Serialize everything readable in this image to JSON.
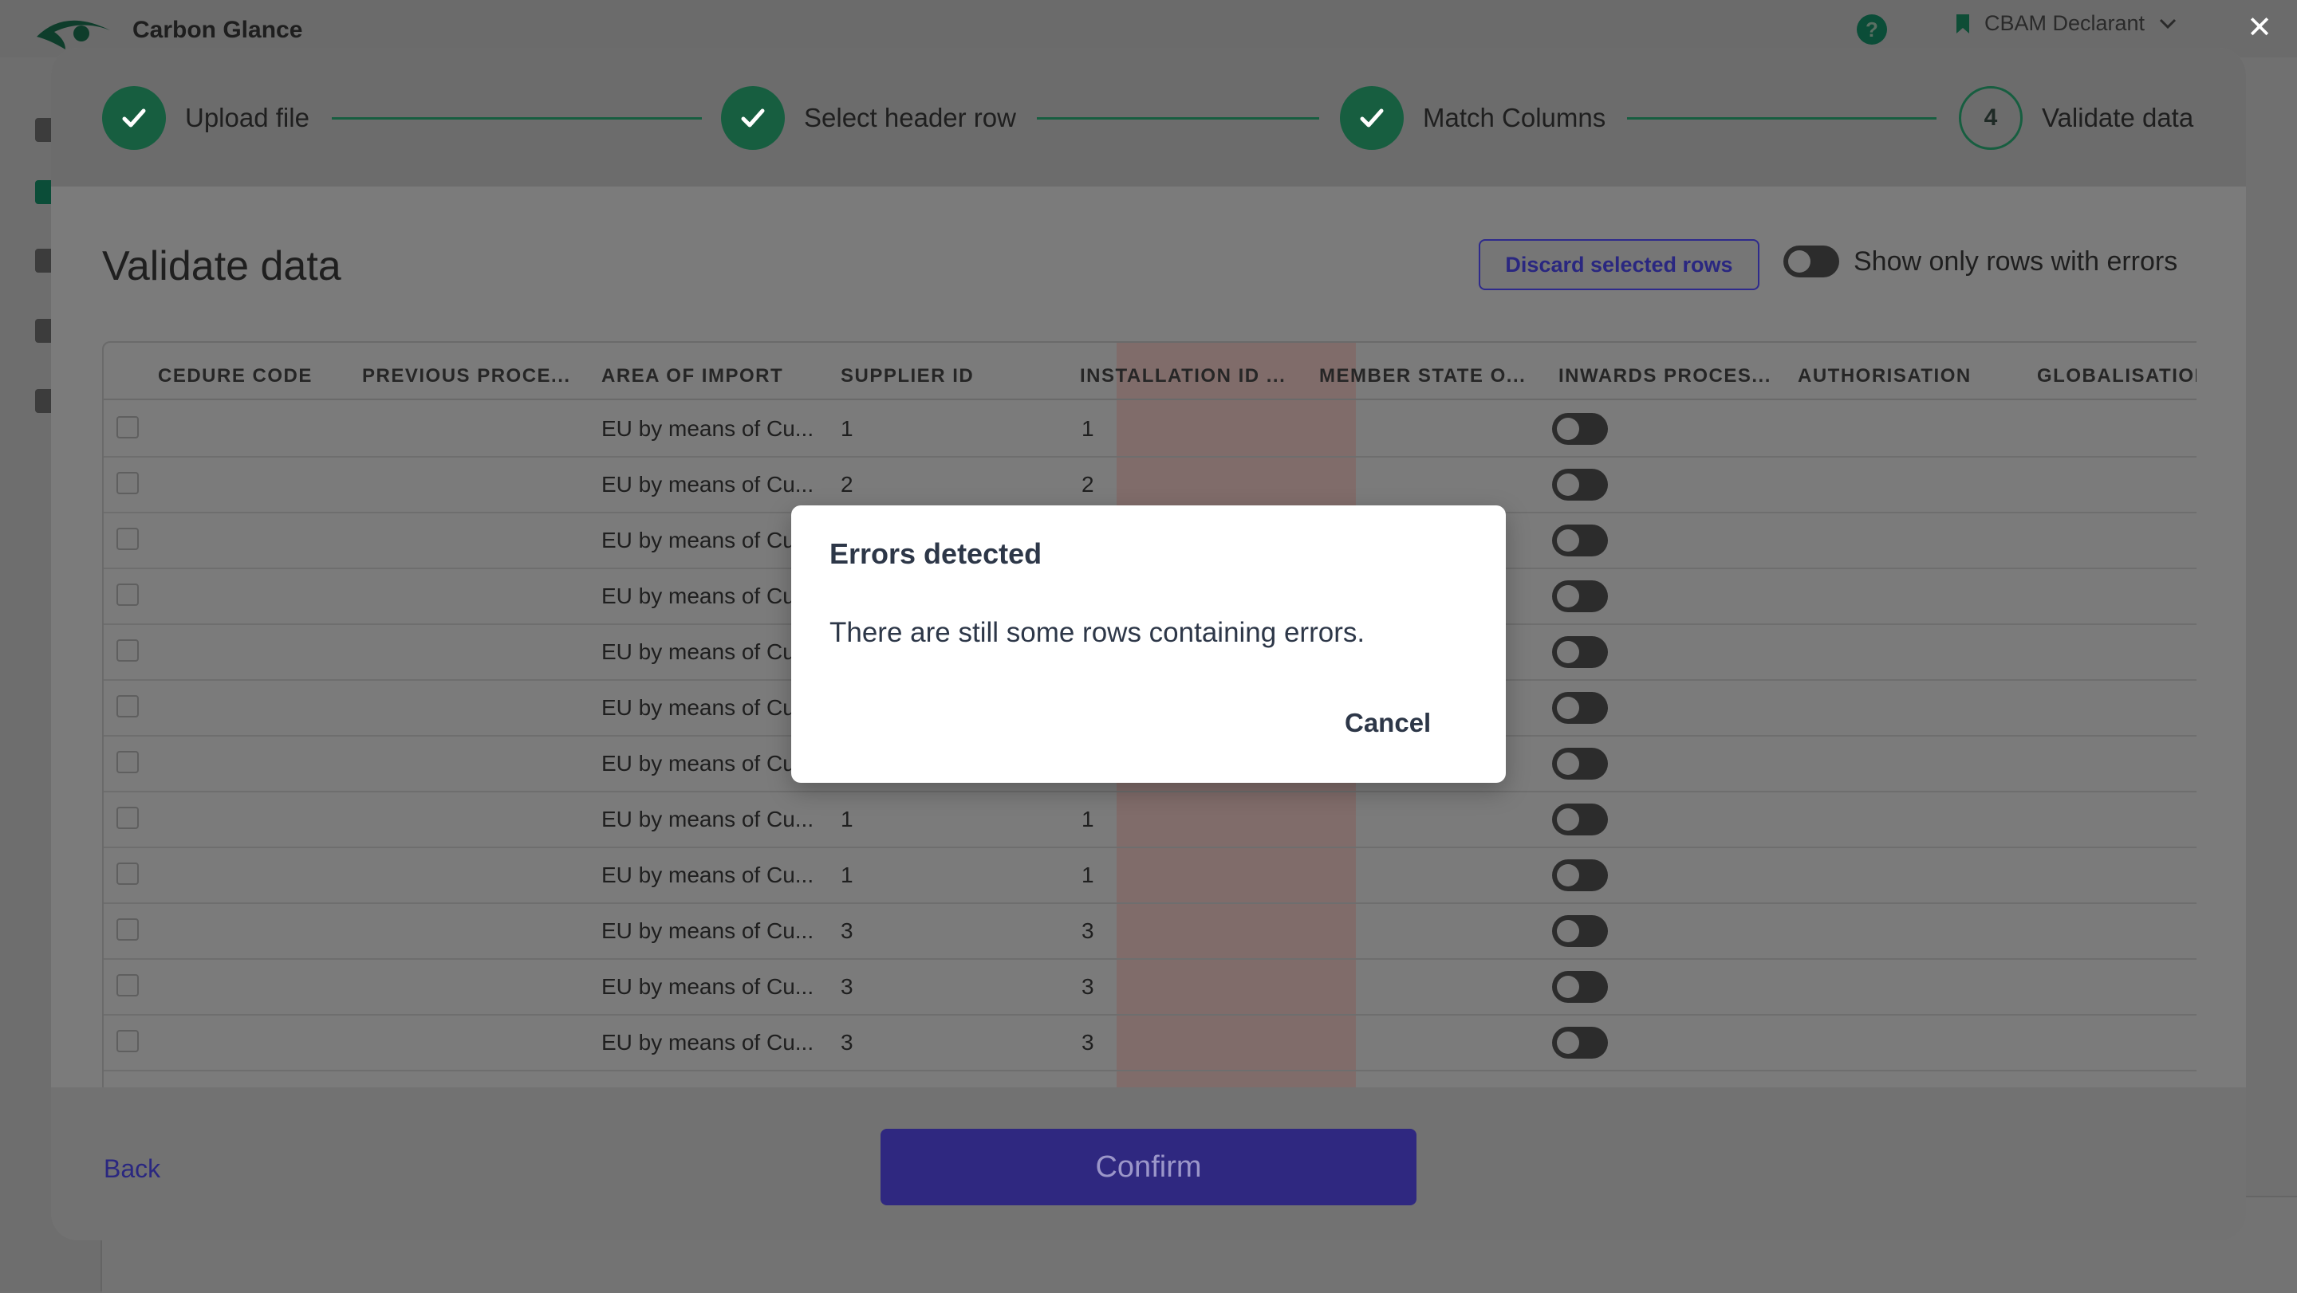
{
  "app": {
    "brand_name": "Carbon Glance",
    "org_name": "CBAM Declarant",
    "help_label": "?",
    "close_label": "✕"
  },
  "stepper": {
    "steps": [
      {
        "label": "Upload file",
        "state": "done"
      },
      {
        "label": "Select header row",
        "state": "done"
      },
      {
        "label": "Match Columns",
        "state": "done"
      },
      {
        "label": "Validate data",
        "state": "current",
        "number": "4"
      }
    ]
  },
  "validate": {
    "title": "Validate data",
    "discard_label": "Discard selected rows",
    "toggle_label": "Show only rows with errors"
  },
  "table": {
    "columns": [
      "CEDURE CODE",
      "PREVIOUS PROCE...",
      "AREA OF IMPORT",
      "SUPPLIER ID",
      "INSTALLATION ID ...",
      "MEMBER STATE O...",
      "INWARDS PROCES...",
      "AUTHORISATION",
      "GLOBALISATIOI"
    ],
    "rows": [
      {
        "area": "EU by means of Cu...",
        "supplier": "1",
        "installation": "1"
      },
      {
        "area": "EU by means of Cu...",
        "supplier": "2",
        "installation": "2"
      },
      {
        "area": "EU by means of Cu",
        "supplier": "",
        "installation": ""
      },
      {
        "area": "EU by means of Cu",
        "supplier": "",
        "installation": ""
      },
      {
        "area": "EU by means of Cu",
        "supplier": "",
        "installation": ""
      },
      {
        "area": "EU by means of Cu",
        "supplier": "",
        "installation": ""
      },
      {
        "area": "EU by means of Cu",
        "supplier": "",
        "installation": ""
      },
      {
        "area": "EU by means of Cu...",
        "supplier": "1",
        "installation": "1"
      },
      {
        "area": "EU by means of Cu...",
        "supplier": "1",
        "installation": "1"
      },
      {
        "area": "EU by means of Cu...",
        "supplier": "3",
        "installation": "3"
      },
      {
        "area": "EU by means of Cu...",
        "supplier": "3",
        "installation": "3"
      },
      {
        "area": "EU by means of Cu...",
        "supplier": "3",
        "installation": "3"
      }
    ]
  },
  "footer": {
    "back_label": "Back",
    "confirm_label": "Confirm"
  },
  "dialog": {
    "title": "Errors detected",
    "message": "There are still some rows containing errors.",
    "cancel_label": "Cancel"
  },
  "colors": {
    "brand_green": "#175e40",
    "accent_purple": "#2f2880",
    "error_highlight": "#806c6a"
  }
}
